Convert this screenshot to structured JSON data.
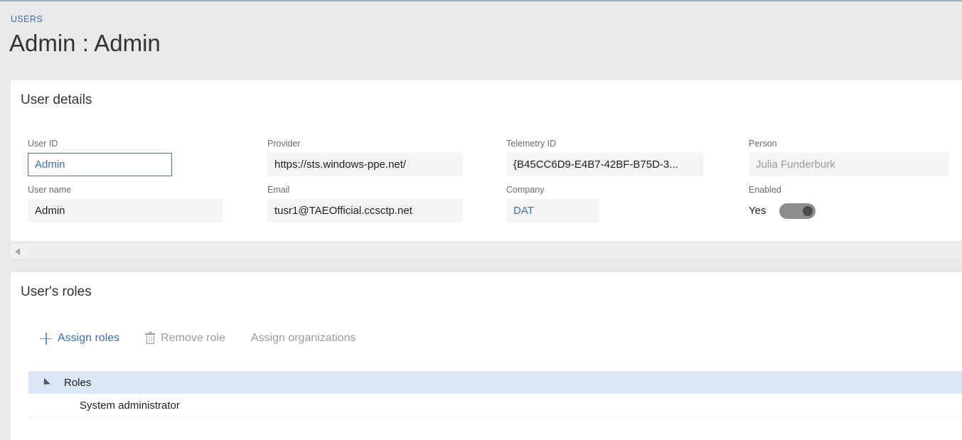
{
  "header": {
    "breadcrumb": "USERS",
    "title": "Admin : Admin"
  },
  "user_details": {
    "heading": "User details",
    "fields": [
      {
        "label": "User ID",
        "value": "Admin",
        "state": "focused"
      },
      {
        "label": "User name",
        "value": "Admin",
        "state": "normal"
      },
      {
        "label": "Provider",
        "value": "https://sts.windows-ppe.net/",
        "state": "normal"
      },
      {
        "label": "Email",
        "value": "tusr1@TAEOfficial.ccsctp.net",
        "state": "normal"
      },
      {
        "label": "Telemetry ID",
        "value": "{B45CC6D9-E4B7-42BF-B75D-3...",
        "state": "normal"
      },
      {
        "label": "Company",
        "value": "DAT",
        "state": "link"
      },
      {
        "label": "Person",
        "value": "Julia Funderburk",
        "state": "muted"
      }
    ],
    "enabled": {
      "label": "Enabled",
      "value": "Yes",
      "toggle_on": true
    }
  },
  "users_roles": {
    "heading": "User's roles",
    "toolbar": [
      {
        "label": "Assign roles",
        "icon": "plus-icon",
        "enabled": true
      },
      {
        "label": "Remove role",
        "icon": "trash-icon",
        "enabled": false
      },
      {
        "label": "Assign organizations",
        "icon": "none",
        "enabled": false
      }
    ],
    "grid": {
      "group_header": "Roles",
      "rows": [
        {
          "name": "System administrator"
        }
      ]
    }
  },
  "colors": {
    "accent": "#3e6faf",
    "page_bg": "#e9e9e9",
    "panel_bg": "#ffffff",
    "field_bg": "#f4f4f4",
    "grid_header_bg": "#dbe7f6",
    "disabled_text": "#9a9a9a"
  }
}
